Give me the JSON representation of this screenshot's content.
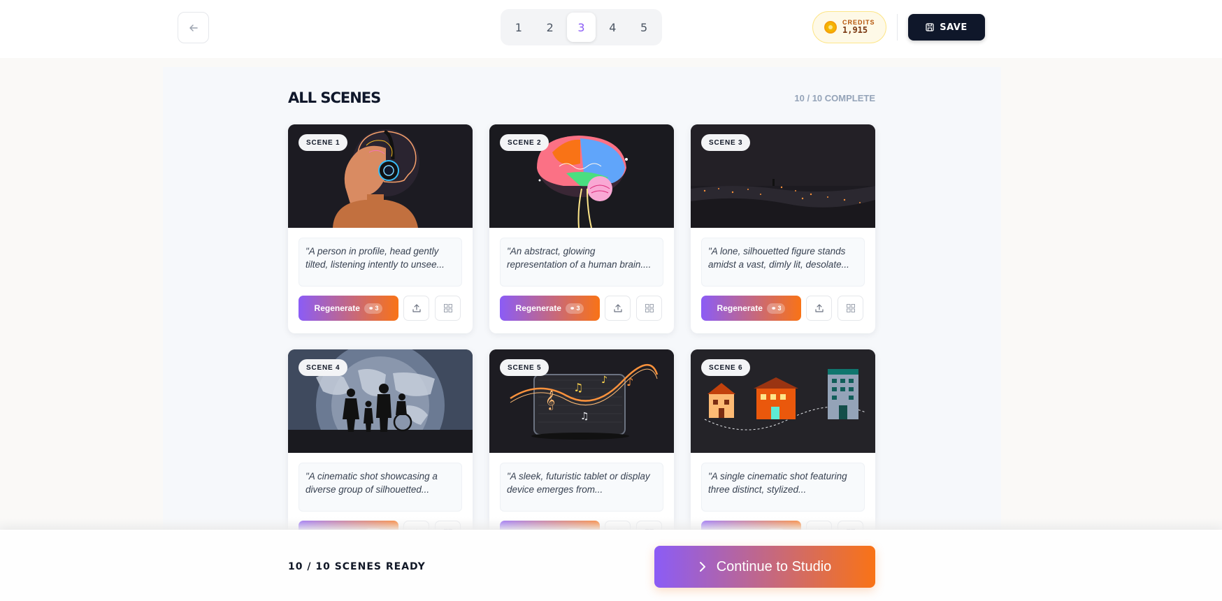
{
  "header": {
    "steps": [
      "1",
      "2",
      "3",
      "4",
      "5"
    ],
    "active_step": "3",
    "credits_label": "CREDITS",
    "credits_value": "1,915",
    "save_label": "SAVE"
  },
  "main": {
    "title": "ALL SCENES",
    "complete_status": "10 / 10 COMPLETE",
    "regenerate_label": "Regenerate",
    "regenerate_count": "3",
    "scenes": [
      {
        "badge": "SCENE 1",
        "prompt": "\"A person in profile, head gently tilted, listening intently to unsee..."
      },
      {
        "badge": "SCENE 2",
        "prompt": "\"An abstract, glowing representation of a human brain...."
      },
      {
        "badge": "SCENE 3",
        "prompt": "\"A lone, silhouetted figure stands amidst a vast, dimly lit, desolate..."
      },
      {
        "badge": "SCENE 4",
        "prompt": "\"A cinematic shot showcasing a diverse group of silhouetted..."
      },
      {
        "badge": "SCENE 5",
        "prompt": "\"A sleek, futuristic tablet or display device emerges from..."
      },
      {
        "badge": "SCENE 6",
        "prompt": "\"A single cinematic shot featuring three distinct, stylized..."
      }
    ]
  },
  "footer": {
    "ready_text": "10 / 10 SCENES READY",
    "continue_label": "Continue to Studio"
  },
  "colors": {
    "accent_start": "#8b5cf6",
    "accent_end": "#f97316",
    "dark": "#0f172a"
  }
}
